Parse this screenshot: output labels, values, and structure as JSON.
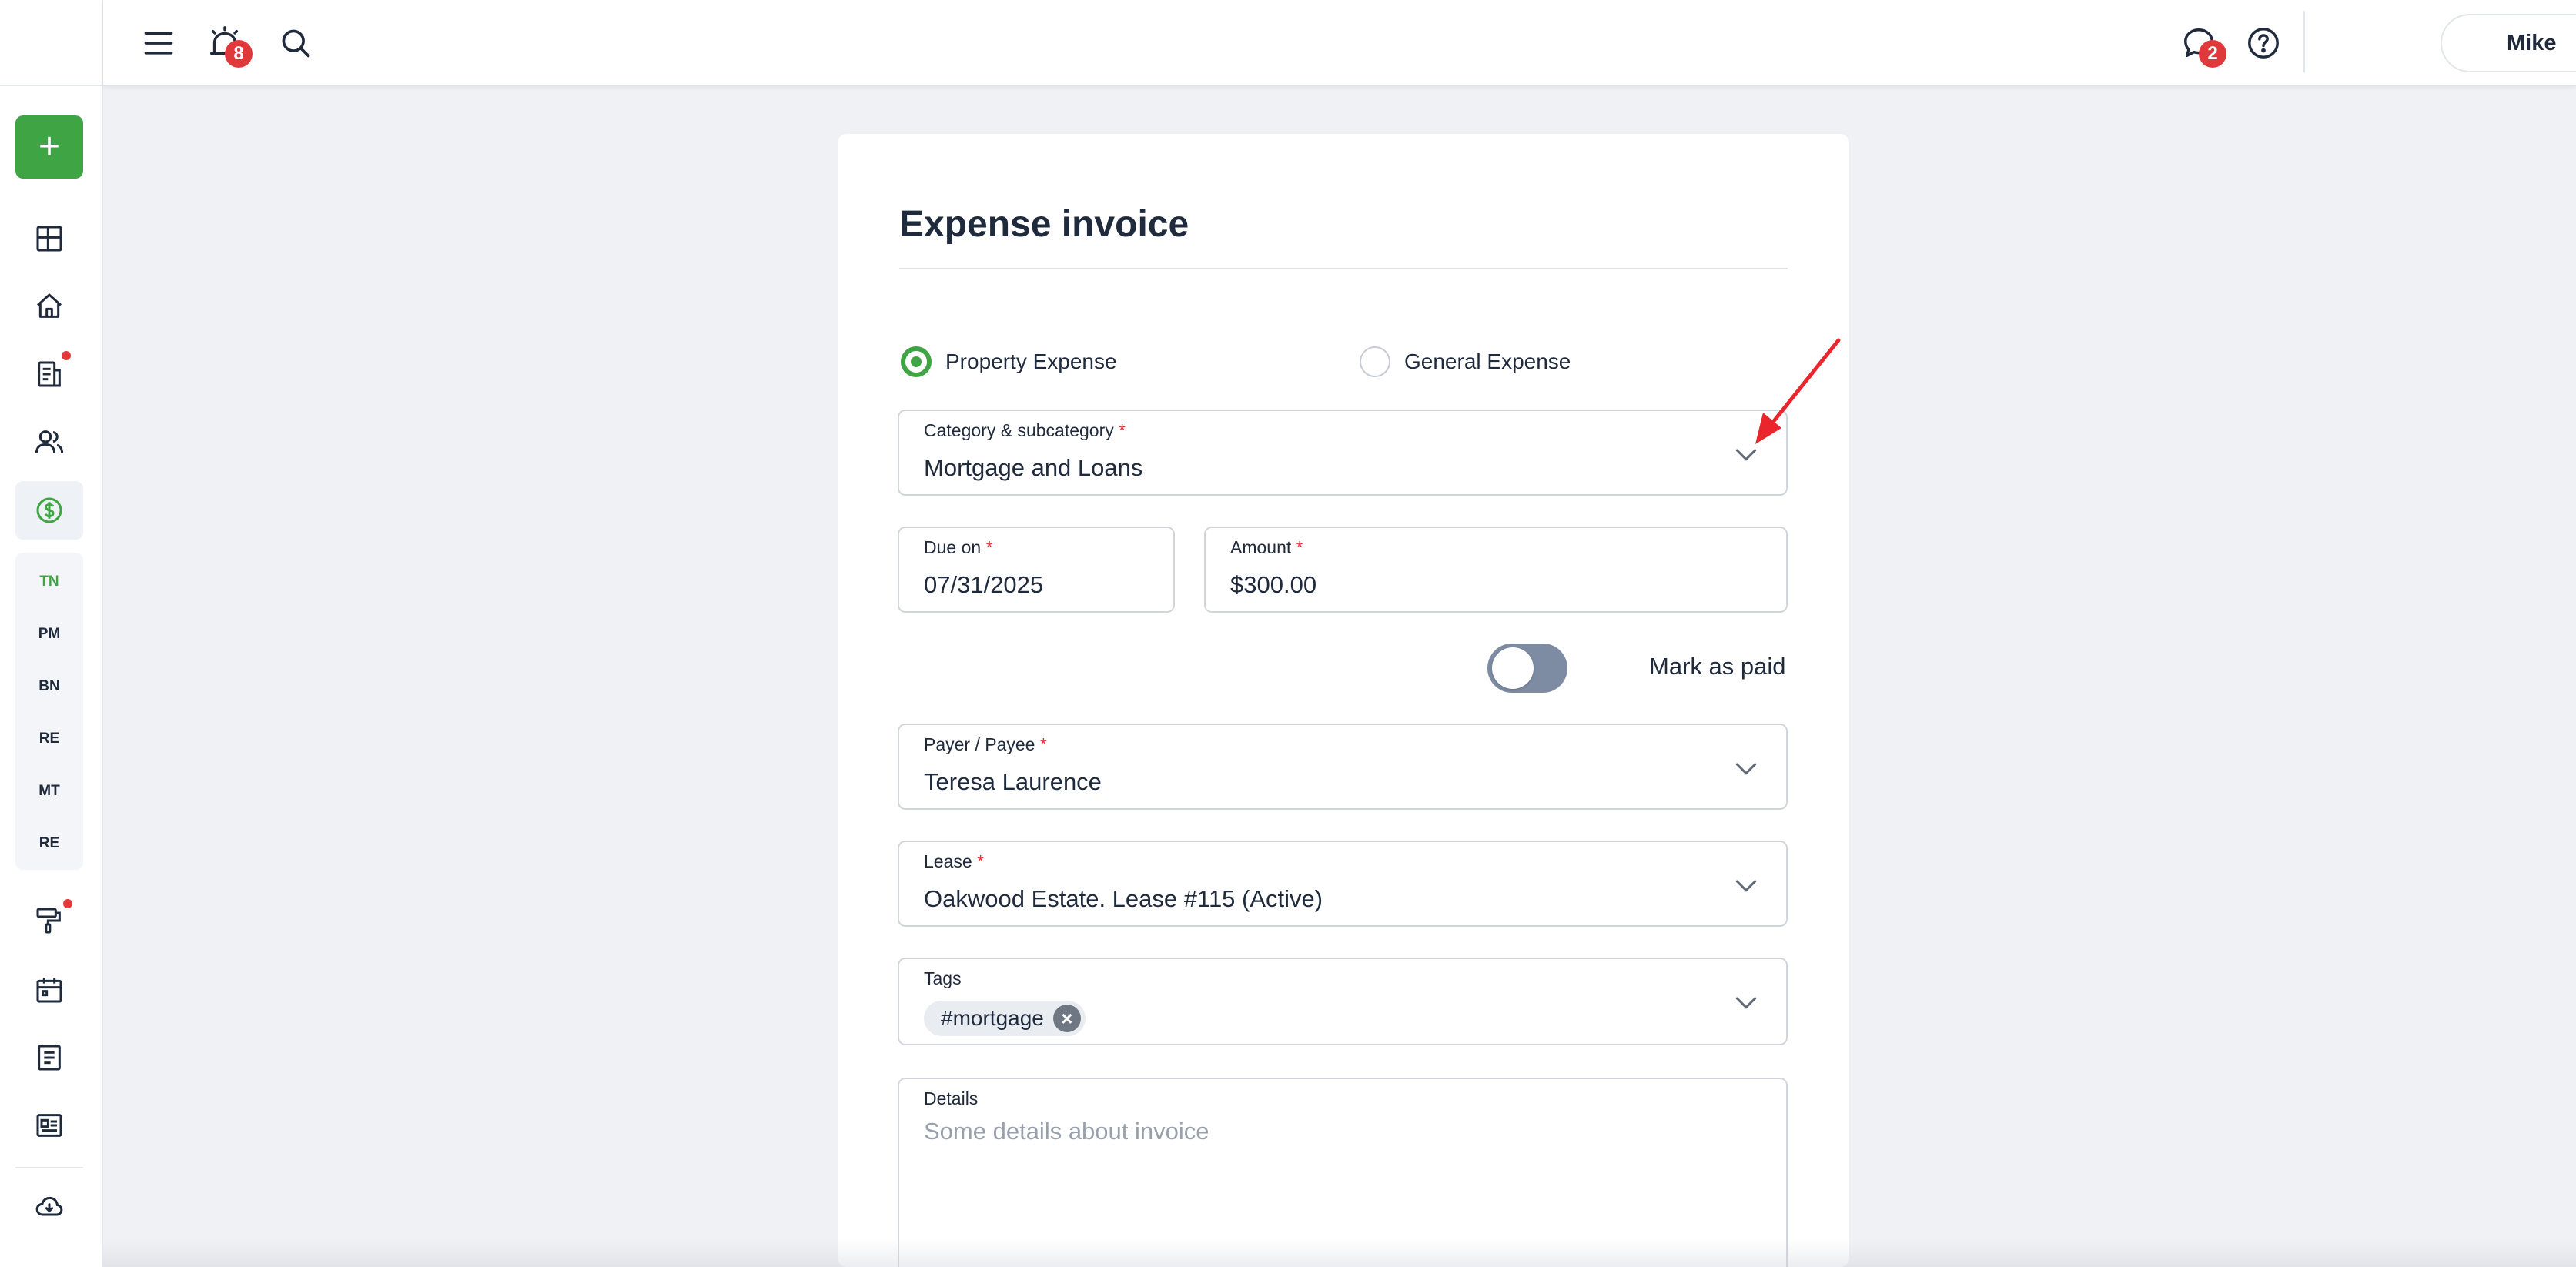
{
  "topbar": {
    "notifications_badge": "8",
    "messages_badge": "2",
    "user_name": "Mike"
  },
  "sidebar": {
    "add_label": "+",
    "subnav": [
      "TN",
      "PM",
      "BN",
      "RE",
      "MT",
      "RE"
    ],
    "active_subnav": "TN"
  },
  "form": {
    "title": "Expense invoice",
    "expense_types": [
      {
        "label": "Property Expense",
        "selected": true
      },
      {
        "label": "General Expense",
        "selected": false
      }
    ],
    "category": {
      "label": "Category & subcategory",
      "value": "Mortgage and Loans"
    },
    "due_on": {
      "label": "Due on",
      "value": "07/31/2025"
    },
    "amount": {
      "label": "Amount",
      "value": "$300.00"
    },
    "mark_as_paid": {
      "label": "Mark as paid",
      "on": false
    },
    "payee": {
      "label": "Payer / Payee",
      "value": "Teresa Laurence"
    },
    "lease": {
      "label": "Lease",
      "value": "Oakwood Estate. Lease #115 (Active)"
    },
    "tags": {
      "label": "Tags",
      "items": [
        "#mortgage"
      ]
    },
    "details": {
      "label": "Details",
      "placeholder": "Some details about invoice"
    },
    "required_mark": "*"
  },
  "colors": {
    "accent": "#3fa544",
    "badge": "#e0393b",
    "annotation_arrow": "#e8262b"
  }
}
